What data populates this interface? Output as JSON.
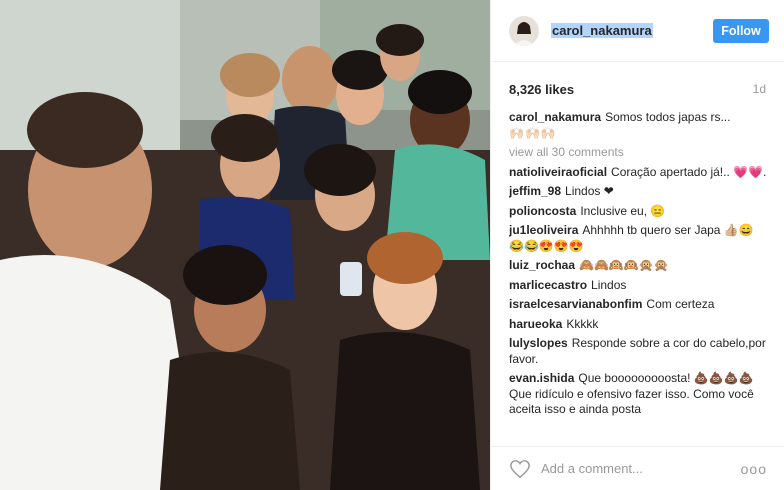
{
  "post": {
    "image_alt_icon": "group-selfie-photo",
    "username": "carol_nakamura",
    "follow_label": "Follow",
    "likes": "8,326 likes",
    "time": "1d",
    "caption_text": "Somos todos japas rs...",
    "caption_emoji": "🙌🏻🙌🏻🙌🏻",
    "view_all": "view all 30 comments",
    "add_comment_placeholder": "Add a comment...",
    "more_label": "ooo"
  },
  "comments": [
    {
      "user": "natioliveiraoficial",
      "text": "Coração apertado já!.. 💗💗."
    },
    {
      "user": "jeffim_98",
      "text": "Lindos ❤"
    },
    {
      "user": "polioncosta",
      "text": "Inclusive eu, 😑"
    },
    {
      "user": "ju1leoliveira",
      "text": "Ahhhhh tb quero ser Japa 👍🏼😄😂😂😍😍😍"
    },
    {
      "user": "luiz_rochaa",
      "text": "🙈🙈🙉🙉🙊🙊"
    },
    {
      "user": "marlicecastro",
      "text": "Lindos"
    },
    {
      "user": "israelcesarvianabonfim",
      "text": "Com certeza"
    },
    {
      "user": "harueoka",
      "text": "Kkkkk"
    },
    {
      "user": "lulyslopes",
      "text": "Responde sobre a cor do cabelo,por favor."
    },
    {
      "user": "evan.ishida",
      "text": "Que booooooooosta! 💩💩💩💩Que ridículo e ofensivo fazer isso. Como você aceita isso e ainda posta"
    }
  ],
  "colors": {
    "accent": "#3897f0",
    "muted": "#999999",
    "highlight": "#b3d4fc"
  }
}
